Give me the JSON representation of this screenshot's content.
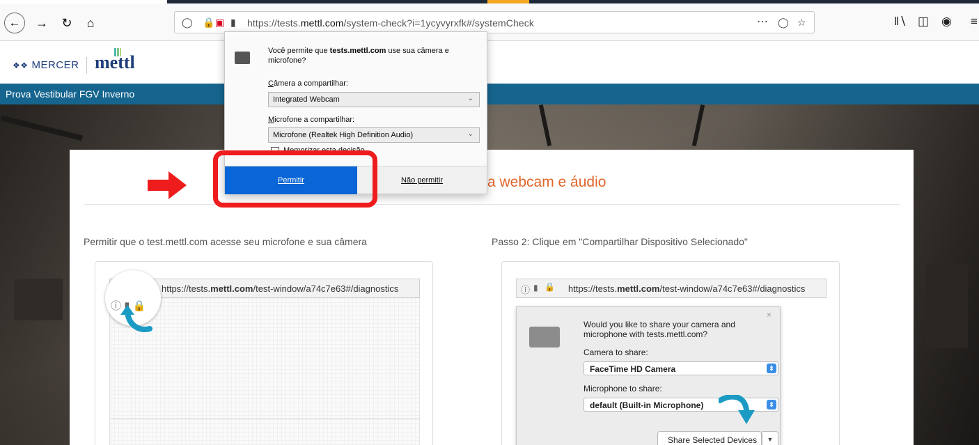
{
  "browser": {
    "url_prefix": "https://tests.",
    "url_domain": "mettl.com",
    "url_suffix": "/system-check?i=1ycyvyrxfk#/systemCheck",
    "icons": [
      "back-icon",
      "forward-icon",
      "reload-icon",
      "home-icon",
      "shield-icon",
      "lock-icon",
      "permissions-icon",
      "camera-icon",
      "more-icon",
      "pocket-icon",
      "star-icon",
      "library-icon",
      "sidebar-icon",
      "account-icon",
      "menu-icon"
    ]
  },
  "header": {
    "mercer": "MERCER",
    "mettl": "mettl"
  },
  "course": {
    "title": "Prova Vestibular FGV Inverno"
  },
  "popup": {
    "question_prefix": "Você permite que ",
    "question_domain": "tests.mettl.com",
    "question_suffix": " use sua câmera e microfone?",
    "camera_label_key": "C",
    "camera_label_rest": "âmera a compartilhar:",
    "camera_value": "Integrated Webcam",
    "mic_label_key": "M",
    "mic_label_rest": "icrofone a compartilhar:",
    "mic_value": "Microfone (Realtek High Definition Audio)",
    "remember_label": "Memorizar esta decisão",
    "allow_key": "P",
    "allow_rest": "ermitir",
    "deny_key": "N",
    "deny_rest": "ão permitir"
  },
  "card": {
    "title": "a webcam e áudio",
    "step1": "Permitir que o test.mettl.com acesse seu microfone e sua câmera",
    "step2": "Passo 2: Clique em \"Compartilhar Dispositivo Selecionado\""
  },
  "example1": {
    "url_prefix": "https://tests.",
    "url_domain": "mettl.com",
    "url_suffix": "/test-window/a74c7e63#/diagnostics"
  },
  "example2": {
    "url_prefix": "https://tests.",
    "url_domain": "mettl.com",
    "url_suffix": "/test-window/a74c7e63#/diagnostics",
    "dialog_question": "Would you like to share your camera and microphone with tests.mettl.com?",
    "camera_label": "Camera to share:",
    "camera_value": "FaceTime HD Camera",
    "mic_label": "Microphone to share:",
    "mic_value": "default (Built-in Microphone)",
    "share_button": "Share Selected Devices",
    "close": "×"
  },
  "colors": {
    "accent_orange": "#e0662a",
    "header_blue": "#16658f",
    "allow_blue": "#0a66d6",
    "highlight_red": "#ee1c1c",
    "arrow_teal": "#1b9bc4"
  }
}
